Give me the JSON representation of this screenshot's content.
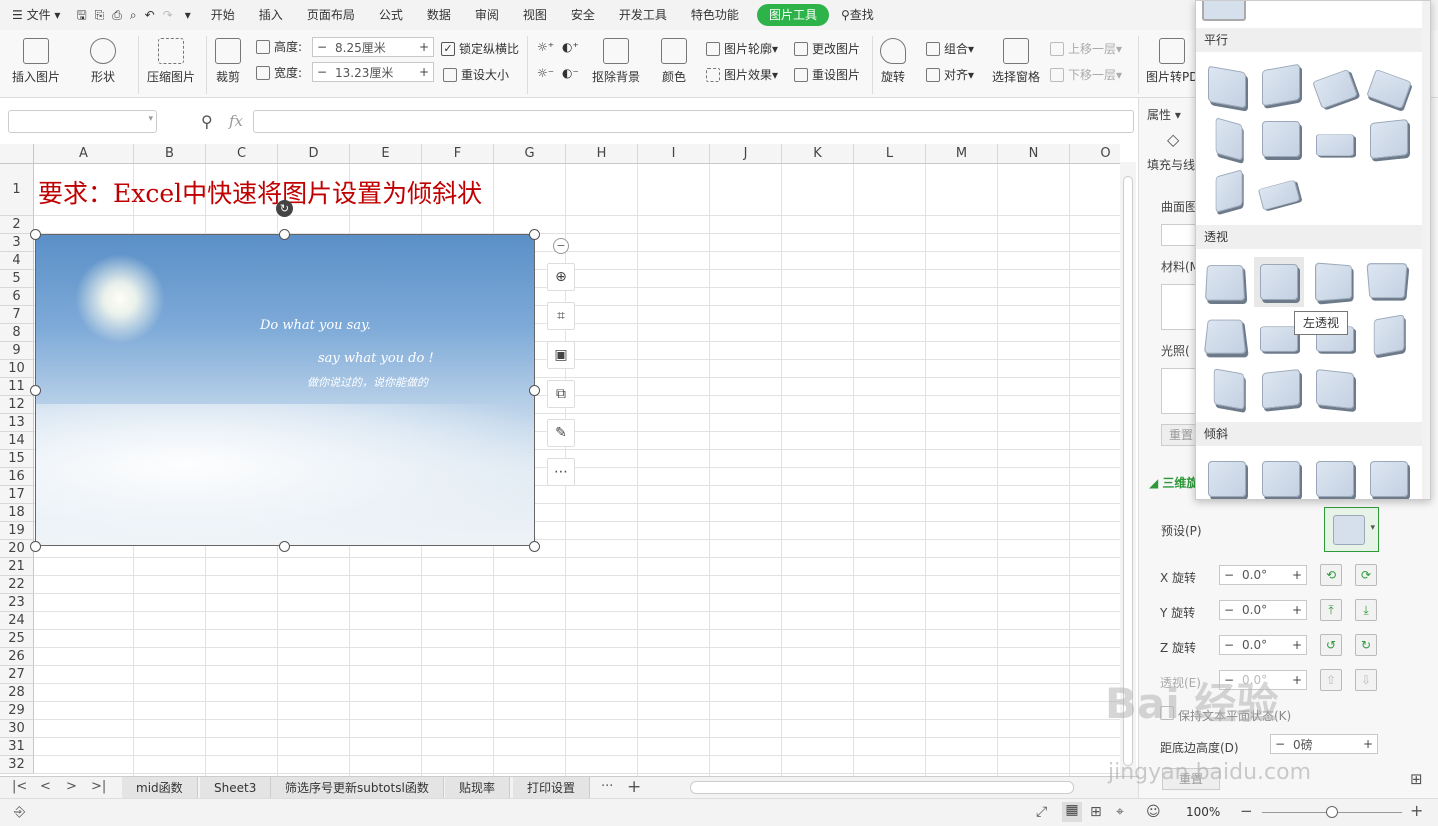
{
  "menubar": {
    "file": "文件",
    "tabs": [
      "开始",
      "插入",
      "页面布局",
      "公式",
      "数据",
      "审阅",
      "视图",
      "安全",
      "开发工具",
      "特色功能",
      "图片工具"
    ],
    "active_tab": "图片工具",
    "search": "查找"
  },
  "ribbon": {
    "insert_picture": "插入图片",
    "shape": "形状",
    "compress": "压缩图片",
    "crop": "裁剪",
    "height_label": "高度:",
    "height_value": "8.25厘米",
    "width_label": "宽度:",
    "width_value": "13.23厘米",
    "lock_ratio": "锁定纵横比",
    "reset_size": "重设大小",
    "remove_bg": "抠除背景",
    "color": "颜色",
    "outline": "图片轮廓",
    "effects": "图片效果",
    "change_pic": "更改图片",
    "reset_pic": "重设图片",
    "rotate": "旋转",
    "group": "组合",
    "align": "对齐",
    "selection_pane": "选择窗格",
    "bring_forward": "上移一层",
    "send_backward": "下移一层",
    "to_pdf": "图片转PD"
  },
  "formula_bar": {
    "fx": "fx",
    "namebox": ""
  },
  "grid": {
    "columns": [
      "A",
      "B",
      "C",
      "D",
      "E",
      "F",
      "G",
      "H",
      "I",
      "J",
      "K",
      "L",
      "M",
      "N",
      "O"
    ],
    "rows": [
      "1",
      "2",
      "3",
      "4",
      "5",
      "6",
      "7",
      "8",
      "9",
      "10",
      "11",
      "12",
      "13",
      "14",
      "15",
      "16",
      "17",
      "18",
      "19",
      "20",
      "21",
      "22",
      "23",
      "24",
      "25",
      "26",
      "27",
      "28",
      "29",
      "30",
      "31",
      "32"
    ],
    "title": "要求：Excel中快速将图片设置为倾斜状"
  },
  "photo": {
    "line1": "Do what you say.",
    "line2": "say what you do !",
    "line3": "做你说过的，说你能做的"
  },
  "sheets": [
    "mid函数",
    "Sheet3",
    "筛选序号更新subtotsl函数",
    "贴现率",
    "打印设置"
  ],
  "sheets_more": "···",
  "status": {
    "zoom": "100%"
  },
  "panel": {
    "title": "属性",
    "fill_line": "填充与线",
    "curved": "曲面图",
    "material": "材料(M",
    "lighting": "光照(",
    "reset": "重置",
    "section_3d": "三维旋",
    "preset": "预设(P)",
    "x_rot": "X 旋转",
    "y_rot": "Y 旋转",
    "z_rot": "Z 旋转",
    "perspective": "透视(E)",
    "x_val": "0.0°",
    "y_val": "0.0°",
    "z_val": "0.0°",
    "p_val": "0.0°",
    "keep_text": "保持文本平面状态(K)",
    "dist_label": "距底边高度(D)",
    "dist_val": "0磅"
  },
  "dropdown": {
    "section_parallel": "平行",
    "section_perspective": "透视",
    "section_oblique": "倾斜",
    "tooltip": "左透视"
  },
  "watermark": {
    "main": "Bai 经验",
    "url": "jingyan.baidu.com"
  }
}
